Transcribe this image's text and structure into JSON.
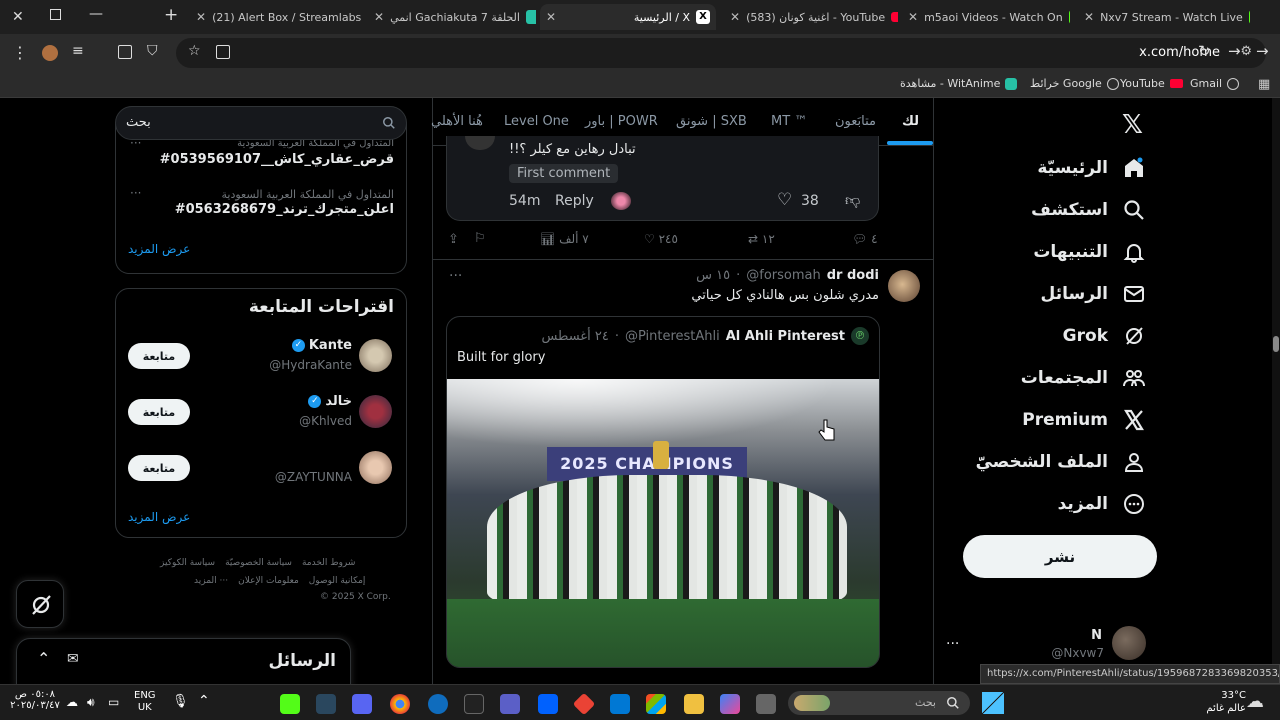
{
  "browser": {
    "tabs": [
      {
        "title": "(21) Alert Box / Streamlabs",
        "favicon_color": "#31c3a2"
      },
      {
        "title": "انمي Gachiakuta الحلقة 7",
        "favicon_color": "#27c1a6"
      },
      {
        "title": "الرئيسية / X",
        "favicon_color": "#ffffff"
      },
      {
        "title": "(583) اغنية كونان - YouTube",
        "favicon_color": "#ff0033"
      },
      {
        "title": "m5aoi Videos - Watch On",
        "favicon_color": "#53fc18"
      },
      {
        "title": "Nxv7 Stream - Watch Live",
        "favicon_color": "#53fc18"
      }
    ],
    "url": "x.com/home",
    "bookmarks": [
      {
        "label": "Gmail",
        "icon": "globe-icon"
      },
      {
        "label": "YouTube",
        "icon": "youtube-icon"
      },
      {
        "label": "خرائط Google",
        "icon": "globe-icon"
      },
      {
        "label": "مشاهدة - WitAnime",
        "icon": "witanime-icon"
      }
    ],
    "status_url": "https://x.com/PinterestAhli/status/1959687283369820353/photo/1"
  },
  "nav": {
    "items": [
      {
        "label": "الرئيسيّة",
        "icon": "home-icon"
      },
      {
        "label": "استكشف",
        "icon": "search-icon"
      },
      {
        "label": "التنبيهات",
        "icon": "bell-icon"
      },
      {
        "label": "الرسائل",
        "icon": "mail-icon"
      },
      {
        "label": "Grok",
        "icon": "grok-icon"
      },
      {
        "label": "المجتمعات",
        "icon": "communities-icon"
      },
      {
        "label": "Premium",
        "icon": "x-logo-icon"
      },
      {
        "label": "الملف الشخصيّ",
        "icon": "person-icon"
      },
      {
        "label": "المزيد",
        "icon": "more-circle-icon"
      }
    ],
    "post_button": "نشر",
    "account": {
      "name": "N",
      "handle": "@Nxvw7"
    }
  },
  "feed_tabs": [
    "لك",
    "متابَعون",
    "MT ™",
    "شونق | SXB",
    "باور | POWR",
    "Level One",
    "هُنا الأهلي"
  ],
  "reply_card": {
    "text": "تبادل رهاين مع كيلر ؟!!",
    "badge": "First comment",
    "time": "54m",
    "reply_label": "Reply",
    "likes": "38"
  },
  "prev_actions": {
    "replies": "٤",
    "reposts": "١٢",
    "likes": "٢٤٥",
    "views": "٧ ألف"
  },
  "post": {
    "name": "dr dodi",
    "handle": "@forsomah",
    "time": "١٥ س",
    "text": "مدري شلون بس هالنادي كل حياتي",
    "quote": {
      "name": "Al Ahli Pinterest",
      "handle": "@PinterestAhli",
      "date": "٢٤ أغسطس",
      "text": "Built for glory",
      "banner_text": "2025 CHAMPIONS"
    }
  },
  "search": {
    "placeholder": "بحث"
  },
  "trends": [
    {
      "meta": "المتداول في المملكة العربية السعودية",
      "tag": "#قرض_عقاري_كاش__0539569107"
    },
    {
      "meta": "المتداول في المملكة العربية السعودية",
      "tag": "#اعلن_متجرك_ترند_0563268679"
    }
  ],
  "show_more": "عرض المزيد",
  "suggestions": {
    "title": "اقتراحات المتابعة",
    "follow_label": "متابعة",
    "users": [
      {
        "name": "Kante",
        "handle": "@HydraKante",
        "verified": true
      },
      {
        "name": "خالد",
        "handle": "@Khlved",
        "verified": true
      },
      {
        "name": "",
        "handle": "@ZAYTUNNA",
        "verified": false
      }
    ]
  },
  "footer": {
    "links_row1": [
      "شروط الخدمة",
      "سياسة الخصوصيّة",
      "سياسة الكوكيز"
    ],
    "links_row2": [
      "إمكانية الوصول",
      "معلومات الإعلان",
      "المزيد ···"
    ],
    "copyright": "© 2025 X Corp."
  },
  "messages_drawer": {
    "title": "الرسائل"
  },
  "taskbar": {
    "search_placeholder": "بحث",
    "weather_temp": "33°C",
    "weather_text": "عالم غائم",
    "lang": "ENG",
    "lang2": "UK",
    "time": "٠٥:٠٨ ص",
    "date": "٢٠٢٥/٠٣/٤٧"
  }
}
